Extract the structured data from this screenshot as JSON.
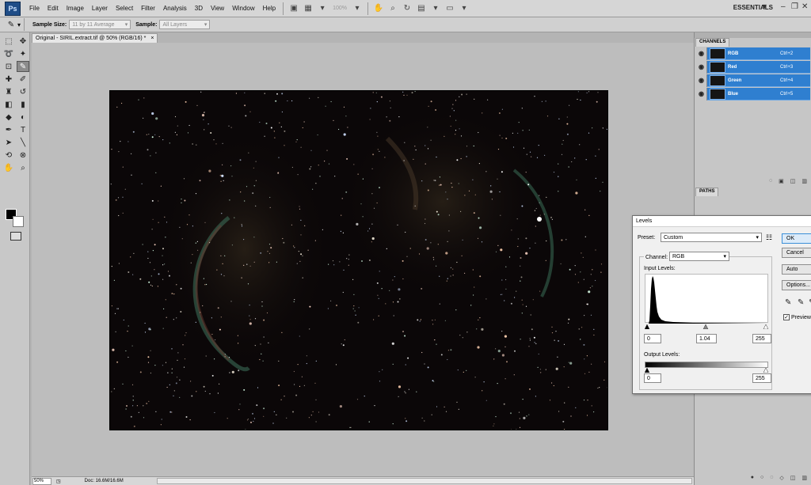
{
  "app": {
    "logo": "Ps",
    "workspace": "ESSENTIALS",
    "zoom_readout": "100%",
    "menu": [
      "File",
      "Edit",
      "Image",
      "Layer",
      "Select",
      "Filter",
      "Analysis",
      "3D",
      "View",
      "Window",
      "Help"
    ]
  },
  "options_bar": {
    "sample_size_label": "Sample Size:",
    "sample_size_value": "11 by 11 Average",
    "sample_label": "Sample:",
    "sample_value": "All Layers"
  },
  "document": {
    "tab_title": "Original - SIRIL.extract.tif @ 50% (RGB/16) *",
    "tab_close": "×"
  },
  "status_bar": {
    "zoom": "50%",
    "doc_info": "Doc: 16.6M/16.6M"
  },
  "panels": {
    "channels_tab": "CHANNELS",
    "paths_tab": "PATHS",
    "channels": [
      {
        "name": "RGB",
        "shortcut": "Ctrl+2"
      },
      {
        "name": "Red",
        "shortcut": "Ctrl+3"
      },
      {
        "name": "Green",
        "shortcut": "Ctrl+4"
      },
      {
        "name": "Blue",
        "shortcut": "Ctrl+5"
      }
    ]
  },
  "levels_dialog": {
    "title": "Levels",
    "preset_label": "Preset:",
    "preset_value": "Custom",
    "channel_label": "Channel:",
    "channel_value": "RGB",
    "input_levels_label": "Input Levels:",
    "output_levels_label": "Output Levels:",
    "input_black": "0",
    "input_gamma": "1.04",
    "input_white": "255",
    "output_black": "0",
    "output_white": "255",
    "buttons": {
      "ok": "OK",
      "cancel": "Cancel",
      "auto": "Auto",
      "options": "Options..."
    },
    "preview_label": "Preview",
    "preview_checked": true
  },
  "colors": {
    "accent": "#2f7fd0",
    "canvas_bg": "#0b0708",
    "workspace": "#bdbdbd"
  }
}
